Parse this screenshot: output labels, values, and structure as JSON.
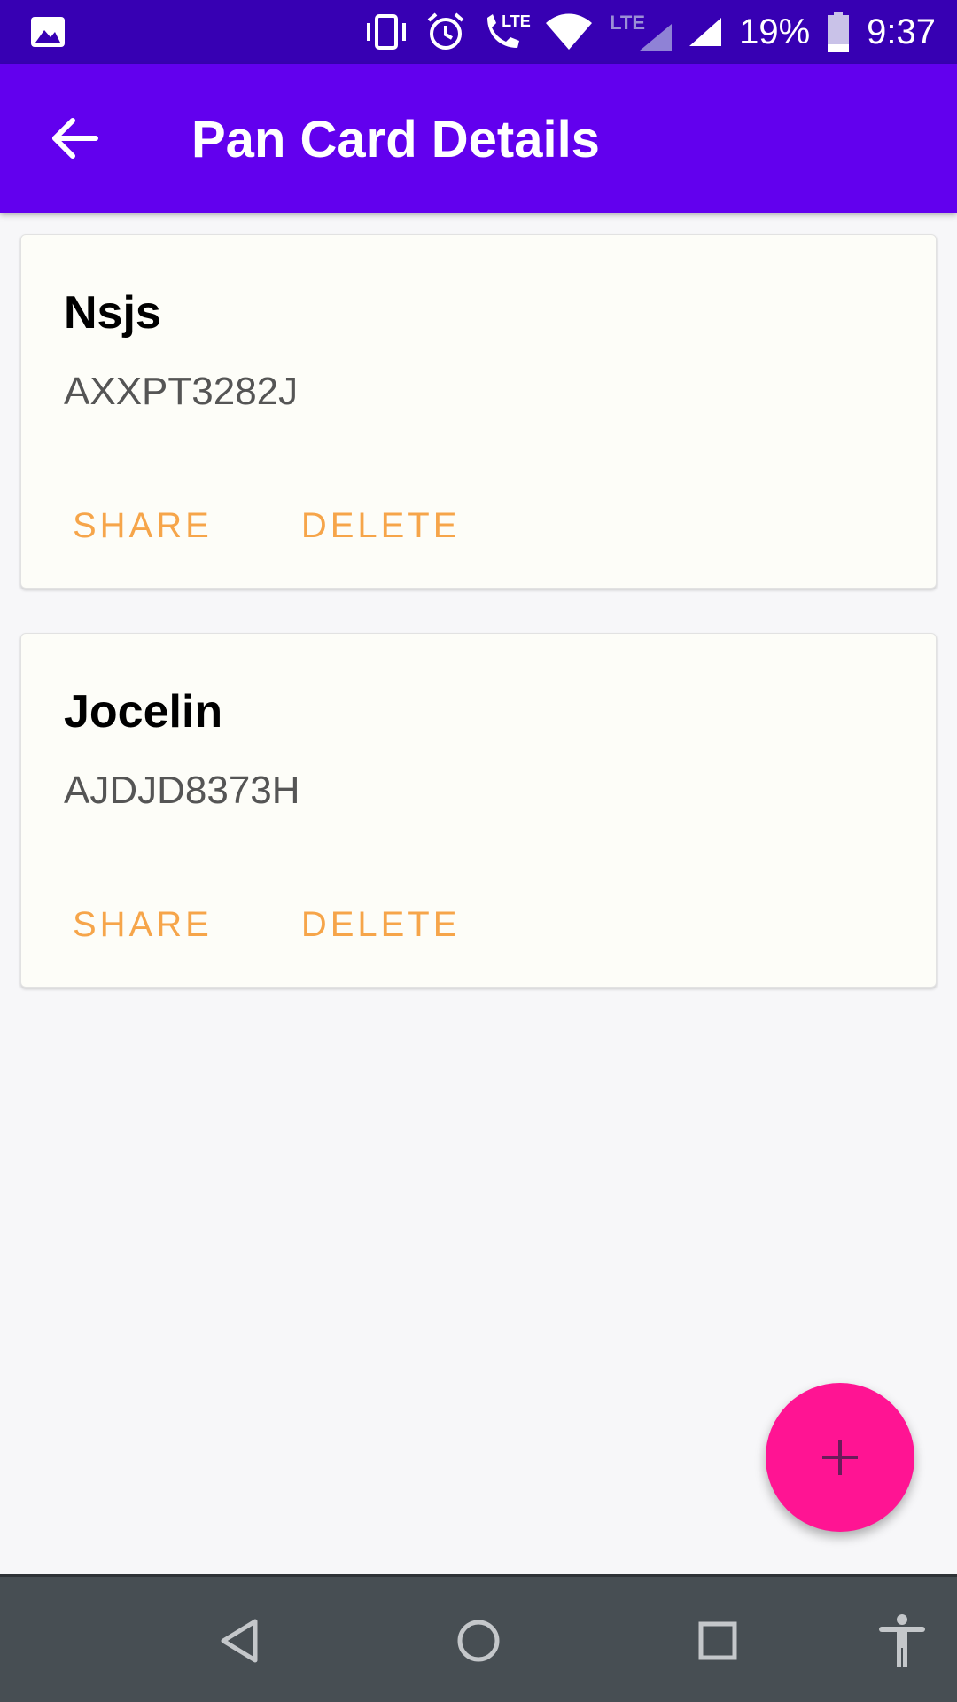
{
  "status_bar": {
    "battery": "19%",
    "time": "9:37",
    "lte_label": "LTE",
    "call_lte_label": "LTE",
    "icons": [
      "image-icon",
      "vibrate-icon",
      "alarm-icon",
      "wifi-calling-icon",
      "wifi-icon",
      "lte-signal-icon",
      "signal-icon",
      "battery-icon"
    ]
  },
  "app_bar": {
    "title": "Pan Card Details",
    "back_icon": "arrow-left-icon"
  },
  "cards": [
    {
      "name": "Nsjs",
      "number": "AXXPT3282J",
      "share_label": "SHARE",
      "delete_label": "DELETE"
    },
    {
      "name": "Jocelin",
      "number": "AJDJD8373H",
      "share_label": "SHARE",
      "delete_label": "DELETE"
    }
  ],
  "fab": {
    "icon": "plus-icon",
    "color": "#ff1493"
  },
  "nav_bar": {
    "icons": [
      "back-triangle-icon",
      "home-circle-icon",
      "recents-square-icon",
      "accessibility-icon"
    ]
  },
  "colors": {
    "status_bar": "#3700b3",
    "app_bar": "#6200ee",
    "accent": "#f6a54a",
    "fab": "#ff1493",
    "nav_bar": "#474e53"
  }
}
